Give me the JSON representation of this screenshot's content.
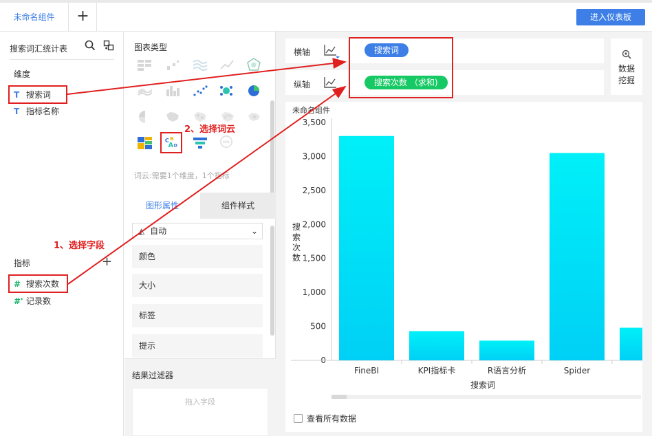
{
  "topbar": {
    "tab_label": "未命名组件",
    "add_tab": "+",
    "enter_dashboard_label": "进入仪表板"
  },
  "left_panel": {
    "table_name": "搜索词汇统计表",
    "dimension_section": "维度",
    "dimensions": [
      {
        "icon": "T",
        "label": "搜索词"
      },
      {
        "icon": "T",
        "label": "指标名称"
      }
    ],
    "measure_section": "指标",
    "add_measure": "+",
    "measures": [
      {
        "icon": "#",
        "label": "搜索次数"
      },
      {
        "icon": "#'",
        "label": "记录数"
      }
    ]
  },
  "middle_panel": {
    "chart_types_title": "图表类型",
    "chart_hint": "词云:需要1个维度，1个指标",
    "tabs": [
      "图形属性",
      "组件样式"
    ],
    "auto_select": "自动",
    "properties": [
      "颜色",
      "大小",
      "标签",
      "提示"
    ],
    "filter_title": "结果过滤器",
    "drop_placeholder": "拖入字段",
    "gauge_icon_label": "60%"
  },
  "right_panel": {
    "x_axis_label": "横轴",
    "y_axis_label": "纵轴",
    "x_axis_field": "搜索词",
    "y_axis_field": "搜索次数 （求和)",
    "data_mining_label": "数据挖掘",
    "component_title": "未命名组件",
    "view_all_data": "查看所有数据"
  },
  "annotations": {
    "step1": "1、选择字段",
    "step2": "2、选择词云"
  },
  "colors": {
    "accent": "#3d7fe6",
    "bar_top": "#00f0f8",
    "bar_bottom": "#00d0f6",
    "highlight": "#e01f1f",
    "pill_x": "#3d7fe6",
    "pill_y": "#17c964"
  },
  "chart_data": {
    "type": "bar",
    "categories": [
      "FineBI",
      "KPI指标卡",
      "R语言分析",
      "Spider",
      ""
    ],
    "values": [
      3300,
      430,
      290,
      3050,
      480
    ],
    "xlabel": "搜索词",
    "ylabel": "搜索次数",
    "ylim": [
      0,
      3500
    ],
    "yticks": [
      0,
      500,
      1000,
      1500,
      2000,
      2500,
      3000,
      3500
    ],
    "ytick_labels": [
      "0",
      "500",
      "1,000",
      "1,500",
      "2,000",
      "2,500",
      "3,000",
      "3,500"
    ],
    "grid": false,
    "legend": "none"
  }
}
